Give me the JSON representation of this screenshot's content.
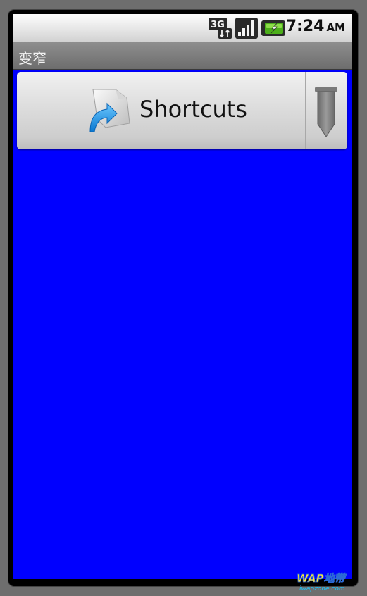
{
  "status_bar": {
    "network_label": "3G",
    "time": "7:24",
    "ampm": "AM",
    "network_icon": "3g-icon",
    "signal_icon": "signal-strength-icon",
    "battery_icon": "battery-charging-icon"
  },
  "title_bar": {
    "title": "变窄"
  },
  "spinner": {
    "selected_label": "Shortcuts",
    "selected_icon": "shortcuts-icon",
    "arrow_icon": "dropdown-arrow-icon"
  },
  "watermark": {
    "title": "WAP地带",
    "url": "iwapzone.com"
  },
  "colors": {
    "background": "#0000ff",
    "status_bar": "#e4e4e4",
    "title_bar": "#7a7a7a",
    "battery_accent": "#4caf1a",
    "shortcut_arrow": "#1e9be8"
  }
}
